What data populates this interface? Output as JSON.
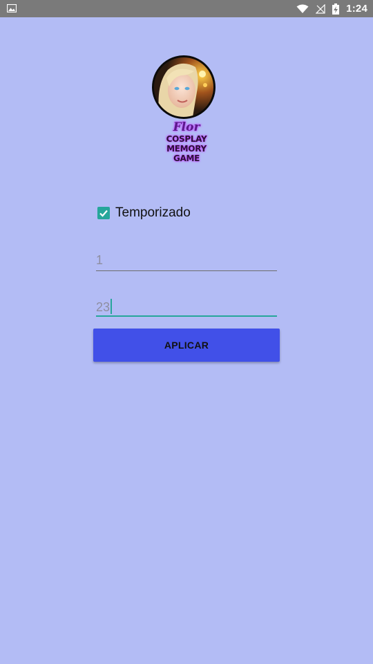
{
  "status_bar": {
    "time": "1:24",
    "icons": [
      "image-icon",
      "wifi-icon",
      "signal-icon",
      "battery-charging-icon"
    ],
    "background": "#7a7a7a"
  },
  "logo": {
    "line1": "Flor",
    "line2": "COSPLAY MEMORY",
    "line3": "GAME",
    "glow_color": "#c23cff"
  },
  "timer_checkbox": {
    "label": "Temporizado",
    "checked": true,
    "color": "#26a69a"
  },
  "fields": [
    {
      "value": "1",
      "focused": false
    },
    {
      "value": "23",
      "focused": true
    }
  ],
  "apply_button": {
    "label": "APLICAR",
    "color": "#4150e8"
  },
  "theme": {
    "background": "#b3bcf5",
    "accent": "#26a69a"
  }
}
